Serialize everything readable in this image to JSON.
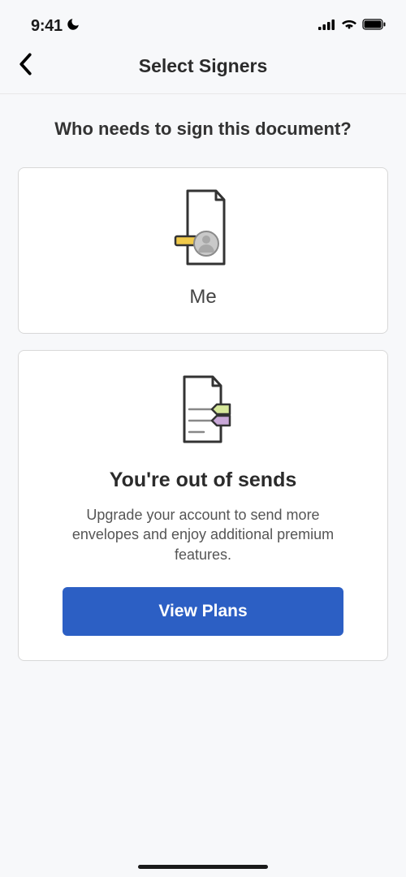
{
  "status_bar": {
    "time": "9:41"
  },
  "nav": {
    "title": "Select Signers"
  },
  "content": {
    "question": "Who needs to sign this document?",
    "me_card": {
      "label": "Me"
    },
    "upgrade_card": {
      "title": "You're out of sends",
      "description": "Upgrade your account to send more envelopes and enjoy additional premium features.",
      "button_label": "View Plans"
    }
  }
}
